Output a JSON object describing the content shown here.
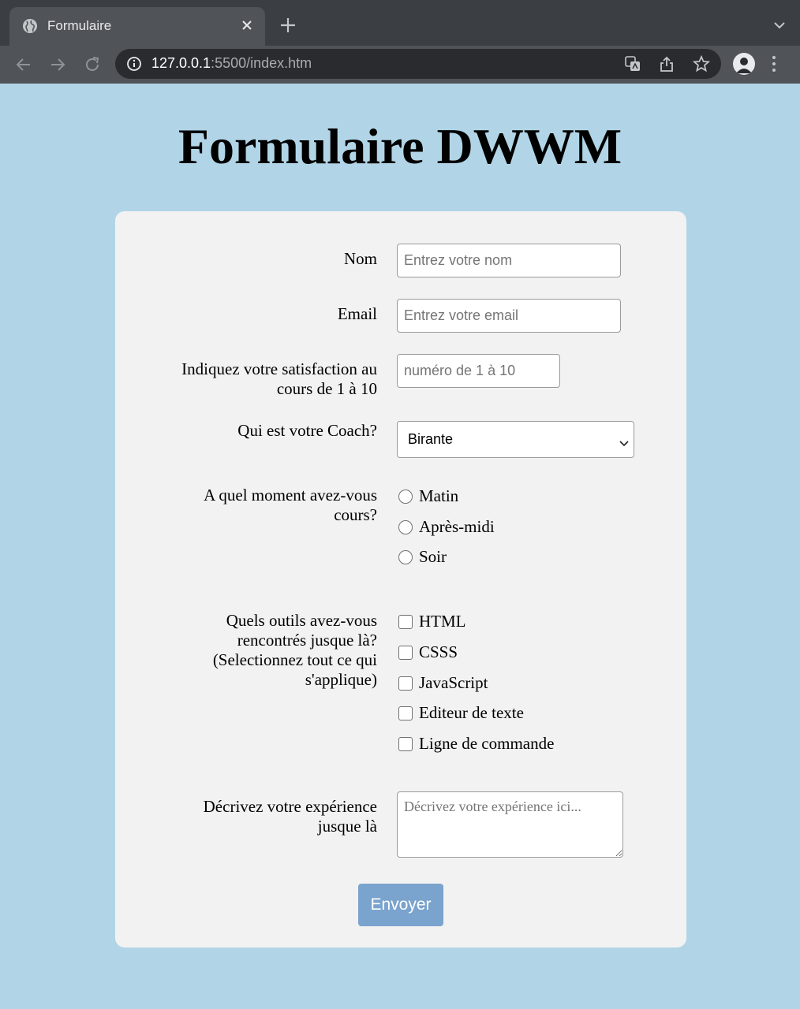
{
  "browser": {
    "tab_title": "Formulaire",
    "url_host": "127.0.0.1",
    "url_rest": ":5500/index.htm"
  },
  "page": {
    "title": "Formulaire DWWM"
  },
  "form": {
    "name": {
      "label": "Nom",
      "placeholder": "Entrez votre nom"
    },
    "email": {
      "label": "Email",
      "placeholder": "Entrez votre email"
    },
    "satisfaction": {
      "label_line1": "Indiquez votre satisfaction au",
      "label_line2": "cours de 1 à 10",
      "placeholder": "numéro de 1 à 10"
    },
    "coach": {
      "label": "Qui est votre Coach?",
      "selected": "Birante"
    },
    "moment": {
      "label_line1": "A quel moment avez-vous",
      "label_line2": "cours?",
      "options": [
        "Matin",
        "Après-midi",
        "Soir"
      ]
    },
    "tools": {
      "label_line1": "Quels outils avez-vous",
      "label_line2": "rencontrés jusque là?",
      "label_line3": "(Selectionnez tout ce qui",
      "label_line4": "s'applique)",
      "options": [
        "HTML",
        "CSSS",
        "JavaScript",
        "Editeur de texte",
        "Ligne de commande"
      ]
    },
    "experience": {
      "label_line1": "Décrivez votre expérience",
      "label_line2": "jusque là",
      "placeholder": "Décrivez votre expérience ici..."
    },
    "submit_label": "Envoyer"
  }
}
